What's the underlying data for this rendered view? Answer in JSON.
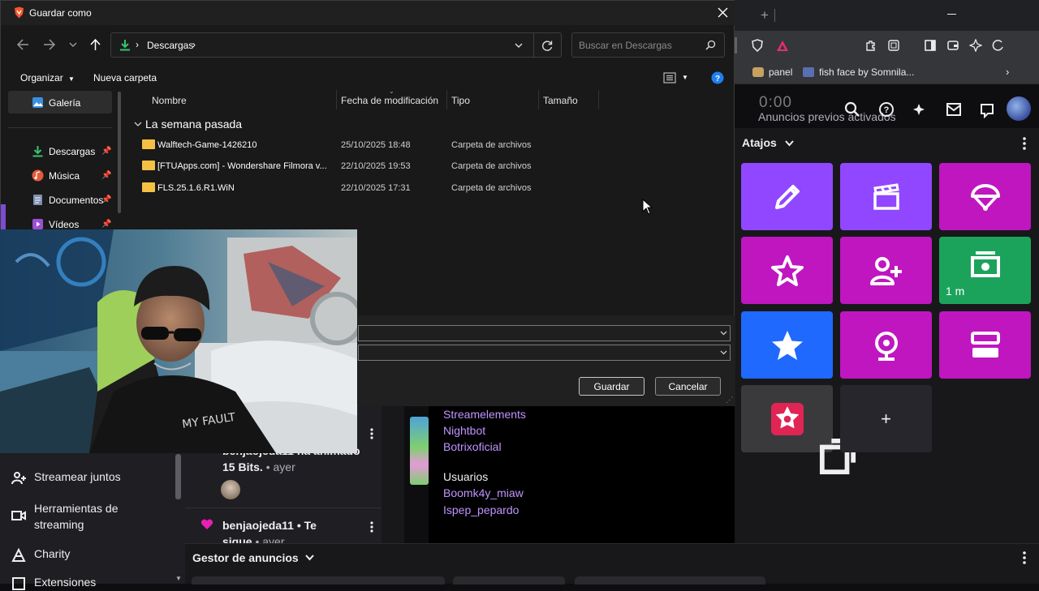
{
  "dialog": {
    "title": "Guardar como",
    "breadcrumb": "Descargas",
    "search_placeholder": "Buscar en Descargas",
    "organize_label": "Organizar",
    "new_folder_label": "Nueva carpeta",
    "nav": [
      {
        "label": "Galería"
      },
      {
        "label": "Descargas"
      },
      {
        "label": "Música"
      },
      {
        "label": "Documentos"
      },
      {
        "label": "Vídeos"
      }
    ],
    "columns": {
      "name": "Nombre",
      "modified": "Fecha de modificación",
      "type": "Tipo",
      "size": "Tamaño"
    },
    "group_label": "La semana pasada",
    "files": [
      {
        "name": "Walftech-Game-1426210",
        "modified": "25/10/2025 18:48",
        "type": "Carpeta de archivos"
      },
      {
        "name": "[FTUApps.com] - Wondershare Filmora v...",
        "modified": "22/10/2025 19:53",
        "type": "Carpeta de archivos"
      },
      {
        "name": "FLS.25.1.6.R1.WiN",
        "modified": "22/10/2025 17:31",
        "type": "Carpeta de archivos"
      }
    ],
    "save_label": "Guardar",
    "cancel_label": "Cancelar"
  },
  "browser": {
    "bookmarks": [
      {
        "label": "panel"
      },
      {
        "label": "fish face by Somnila..."
      }
    ]
  },
  "stream": {
    "timer": "0:00",
    "ads_status": "Anuncios previos activados",
    "shortcuts_title": "Atajos",
    "shortcut_timer_label": "1 m"
  },
  "left_nav": [
    {
      "label": "Streamear juntos"
    },
    {
      "label": "Herramientas de streaming"
    },
    {
      "label": "Charity"
    },
    {
      "label": "Extensiones"
    }
  ],
  "feed": {
    "item1_line1": "benjaojeda11 ha animado",
    "item1_line2": "15 Bits.",
    "item1_time": "• ayer",
    "item2_user": "benjaojeda11",
    "item2_action": "• Te",
    "item2_action2": "sigue",
    "item2_time": "• ayer"
  },
  "chat": {
    "bots": [
      "Streamelements",
      "Nightbot",
      "Botrixoficial"
    ],
    "users_heading": "Usuarios",
    "users": [
      "Boomk4y_miaw",
      "Ispep_pepardo"
    ]
  },
  "gestor": {
    "label": "Gestor de anuncios"
  },
  "colors": {
    "twitch_purple": "#9147ff",
    "magenta": "#bf16c0",
    "green": "#1ca35b",
    "blue": "#1f69ff",
    "link_purple": "#bf94ff"
  }
}
